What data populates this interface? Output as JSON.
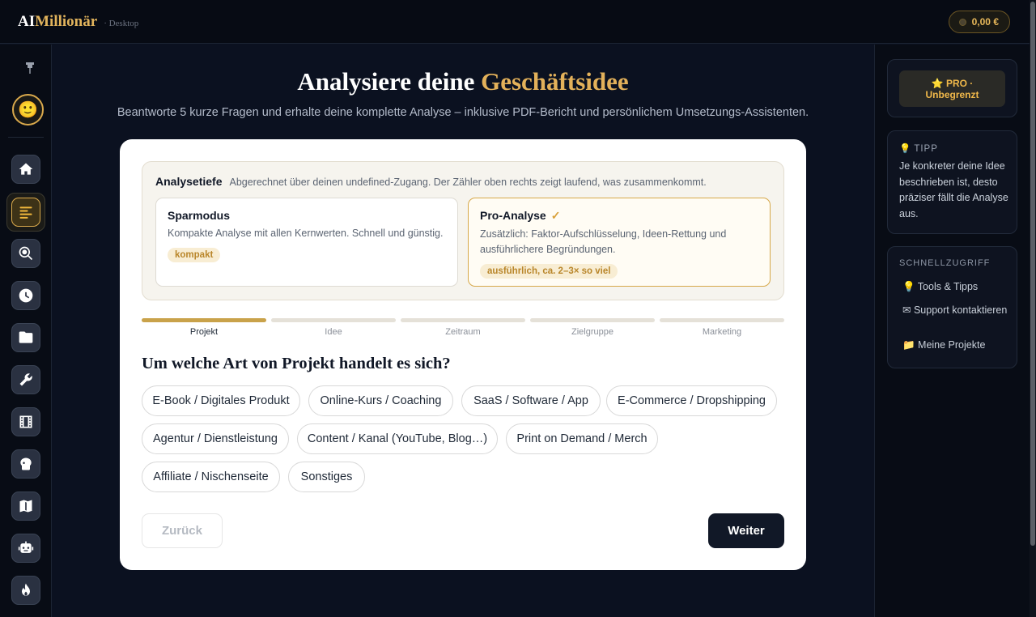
{
  "app": {
    "logo_part1": "AI",
    "logo_part2": "Millionär",
    "logo_sub": "· Desktop",
    "balance": "0,00 €",
    "accent_color": "#e0b35c"
  },
  "sidebar": {
    "avatar_emoji": "🙂",
    "pin_icon": "pin-icon",
    "items": [
      {
        "name": "home",
        "icon": "home-icon"
      },
      {
        "name": "analysis",
        "icon": "list-icon",
        "active": true
      },
      {
        "name": "search",
        "icon": "magnifier-icon"
      },
      {
        "name": "history",
        "icon": "clock-icon"
      },
      {
        "name": "projects",
        "icon": "folder-icon"
      },
      {
        "name": "tools",
        "icon": "wrench-icon"
      },
      {
        "name": "media",
        "icon": "film-icon"
      },
      {
        "name": "brain",
        "icon": "brain-icon"
      },
      {
        "name": "map",
        "icon": "map-icon"
      },
      {
        "name": "assistant",
        "icon": "robot-icon"
      },
      {
        "name": "hot",
        "icon": "flame-icon"
      }
    ]
  },
  "main": {
    "title_part1": "Analysiere deine ",
    "title_part2": "Geschäftsidee",
    "subtitle": "Beantworte 5 kurze Fragen und erhalte deine komplette Analyse – inklusive PDF-Bericht und persönlichem Umsetzungs-Assistenten.",
    "depth": {
      "title": "Analysetiefe",
      "note": "Abgerechnet über deinen undefined-Zugang. Der Zähler oben rechts zeigt laufend, was zusammenkommt.",
      "options": [
        {
          "title": "Sparmodus",
          "check": "",
          "desc": "Kompakte Analyse mit allen Kernwerten. Schnell und günstig.",
          "tag": "kompakt",
          "selected": false
        },
        {
          "title": "Pro-Analyse",
          "check": "✓",
          "desc": "Zusätzlich: Faktor-Aufschlüsselung, Ideen-Rettung und ausführlichere Begründungen.",
          "tag": "ausführlich, ca. 2–3× so viel",
          "selected": true
        }
      ]
    },
    "steps": [
      {
        "label": "Projekt",
        "active": true
      },
      {
        "label": "Idee",
        "active": false
      },
      {
        "label": "Zeitraum",
        "active": false
      },
      {
        "label": "Zielgruppe",
        "active": false
      },
      {
        "label": "Marketing",
        "active": false
      }
    ],
    "question": "Um welche Art von Projekt handelt es sich?",
    "chips": [
      "E-Book / Digitales Produkt",
      "Online-Kurs / Coaching",
      "SaaS / Software / App",
      "E-Commerce / Dropshipping",
      "Agentur / Dienstleistung",
      "Content / Kanal (YouTube, Blog…)",
      "Print on Demand / Merch",
      "Affiliate / Nischenseite",
      "Sonstiges"
    ],
    "back_label": "Zurück",
    "next_label": "Weiter"
  },
  "right": {
    "pro_line1": "⭐ PRO ·",
    "pro_line2": "Unbegrenzt",
    "tip_icon": "💡",
    "tip_title": "TIPP",
    "tip_text": "Je konkreter deine Idee beschrieben ist, desto präziser fällt die Analyse aus.",
    "quick_title": "SCHNELLZUGRIFF",
    "quick_items": [
      "💡 Tools & Tipps",
      "✉ Support kontaktieren",
      "📁 Meine Projekte"
    ]
  }
}
